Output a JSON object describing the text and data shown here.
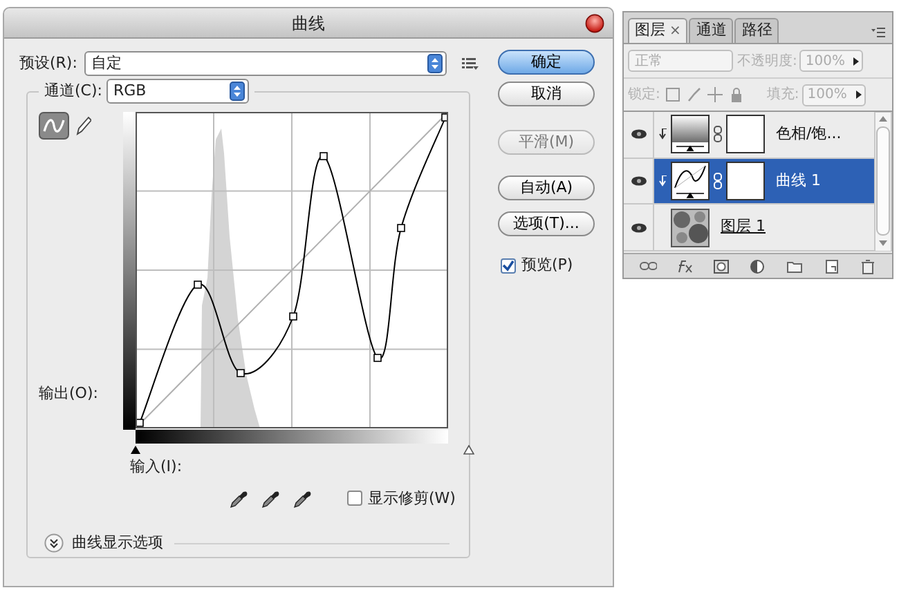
{
  "dialog": {
    "title": "曲线",
    "preset": {
      "label": "预设(R):",
      "value": "自定"
    },
    "channel": {
      "label": "通道(C):",
      "value": "RGB"
    },
    "output_label": "输出(O):",
    "input_label": "输入(I):",
    "show_clipping": {
      "label": "显示修剪(W)",
      "checked": false
    },
    "display_options": "曲线显示选项",
    "buttons": [
      {
        "label": "确定",
        "kind": "default",
        "disabled": false
      },
      {
        "label": "取消",
        "kind": "normal",
        "disabled": false
      },
      {
        "label": "平滑(M)",
        "kind": "normal",
        "disabled": true
      },
      {
        "label": "自动(A)",
        "kind": "normal",
        "disabled": false
      },
      {
        "label": "选项(T)...",
        "kind": "normal",
        "disabled": false
      }
    ],
    "preview": {
      "label": "预览(P)",
      "checked": true
    }
  },
  "layers_panel": {
    "tabs": [
      {
        "label": "图层",
        "close": "×",
        "selected": true
      },
      {
        "label": "通道",
        "selected": false
      },
      {
        "label": "路径",
        "selected": false
      }
    ],
    "blend_mode": "正常",
    "opacity_label": "不透明度:",
    "opacity": "100%",
    "lock_label": "锁定:",
    "fill_label": "填充:",
    "fill": "100%",
    "layers": [
      {
        "name": "色相/饱...",
        "kind": "hue",
        "selected": false,
        "visible": true,
        "clipped": true
      },
      {
        "name": "曲线 1",
        "kind": "curves",
        "selected": true,
        "visible": true,
        "clipped": true
      },
      {
        "name": "图层 1",
        "kind": "pixel",
        "selected": false,
        "visible": true,
        "clipped": false
      }
    ]
  }
}
